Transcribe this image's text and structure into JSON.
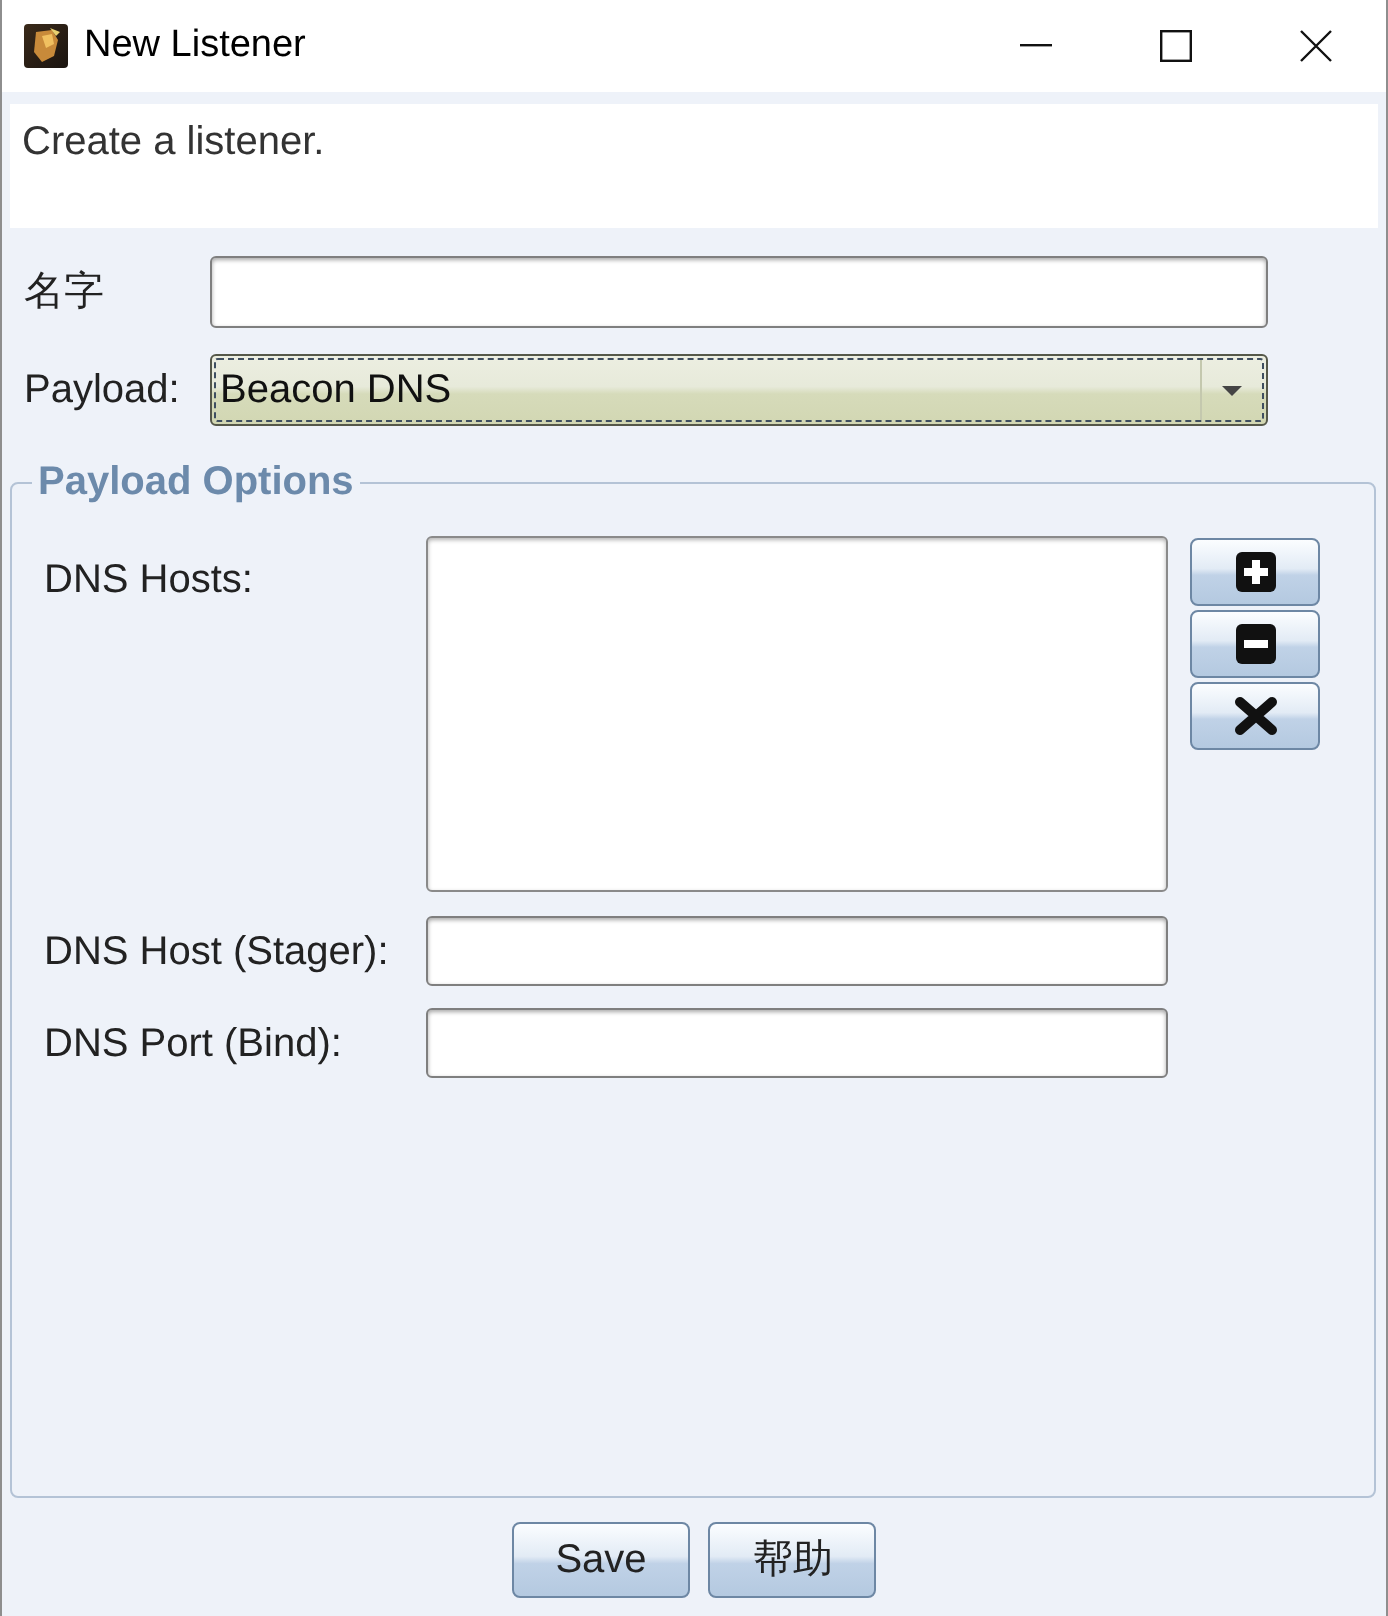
{
  "window": {
    "title": "New Listener"
  },
  "description": "Create a listener.",
  "fields": [
    {
      "label": "名字",
      "kind": "text"
    },
    {
      "label": "Payload:",
      "kind": "combo",
      "value": "Beacon DNS",
      "focused": true
    }
  ],
  "payload_options": {
    "title": "Payload Options",
    "fields": [
      {
        "label": "DNS Hosts:",
        "kind": "list",
        "buttons": [
          {
            "kind": "add"
          },
          {
            "kind": "remove"
          },
          {
            "kind": "clear"
          }
        ]
      },
      {
        "label": "DNS Host (Stager):",
        "kind": "text"
      },
      {
        "label": "DNS Port (Bind):",
        "kind": "text"
      }
    ]
  },
  "buttons": [
    "Save",
    "帮助"
  ]
}
